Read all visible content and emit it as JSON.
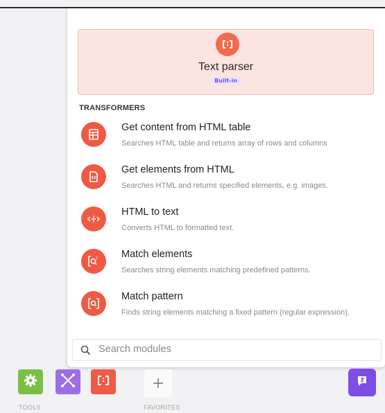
{
  "header": {
    "icon": "text-parser-icon",
    "title": "Text parser",
    "badge": "Built-in"
  },
  "section": {
    "label": "TRANSFORMERS"
  },
  "items": [
    {
      "icon": "table-icon",
      "title": "Get content from HTML table",
      "desc": "Searches HTML table and returns array of rows and columns"
    },
    {
      "icon": "html-file-icon",
      "title": "Get elements from HTML",
      "desc": "Searches HTML and returns specified elements, e.g. images."
    },
    {
      "icon": "html-to-text-icon",
      "title": "HTML to text",
      "desc": "Converts HTML to formatted text."
    },
    {
      "icon": "match-elements-icon",
      "title": "Match elements",
      "desc": "Searches string elements matching predefined patterns."
    },
    {
      "icon": "match-pattern-icon",
      "title": "Match pattern",
      "desc": "Finds string elements matching a fixed pattern (regular expression)."
    }
  ],
  "search": {
    "placeholder": "Search modules",
    "value": ""
  },
  "toolbar": {
    "tools_label": "TOOLS",
    "favorites_label": "FAVORITES",
    "favorites_add": "+"
  },
  "colors": {
    "accent": "#f05a44",
    "header_bg": "#fce4e0",
    "badge_bg": "#ece4ff",
    "badge_text": "#7a4fe0",
    "tools_green": "#7ac143",
    "flow_purple": "#9b6ee8",
    "chat_purple": "#7d4de6"
  }
}
